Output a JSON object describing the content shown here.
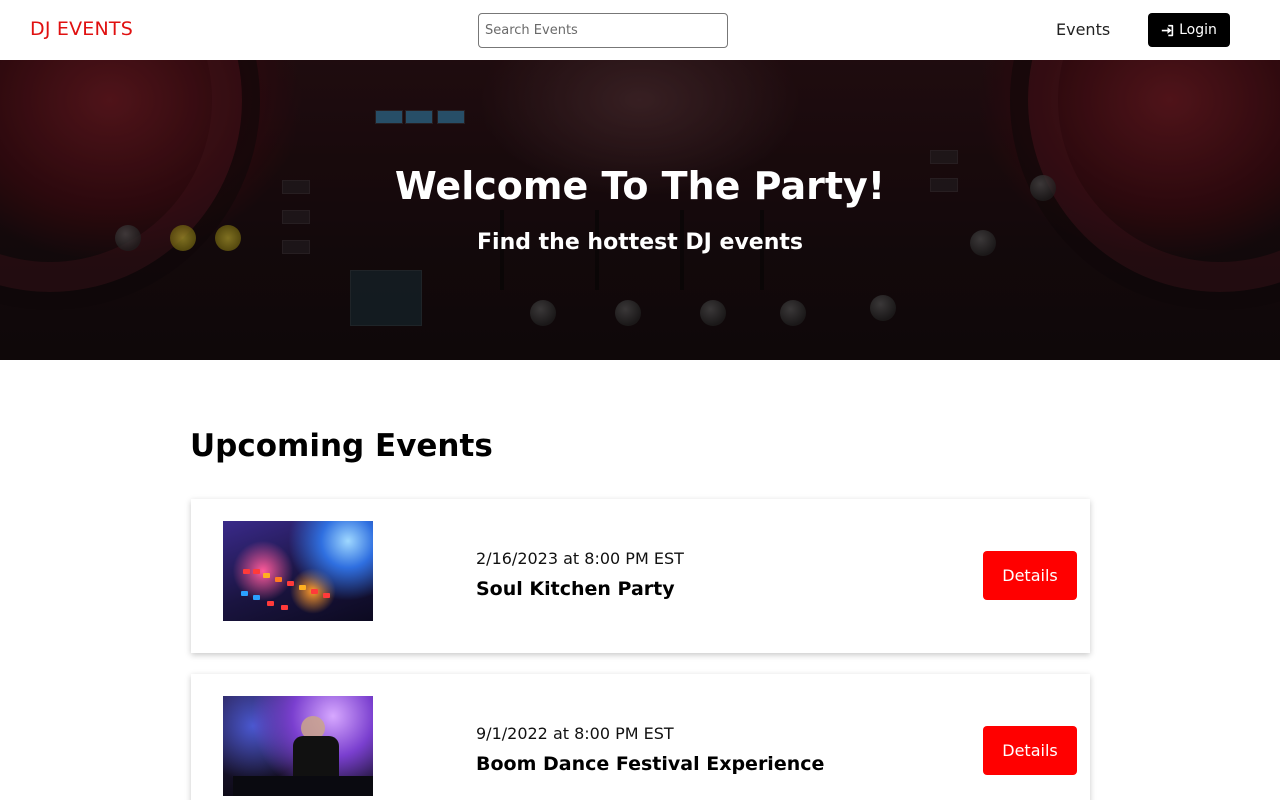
{
  "header": {
    "logo": "DJ EVENTS",
    "search_placeholder": "Search Events",
    "nav_events": "Events",
    "login_label": "Login"
  },
  "hero": {
    "title": "Welcome To The Party!",
    "subtitle": "Find the hottest DJ events"
  },
  "main": {
    "section_title": "Upcoming Events",
    "events": [
      {
        "date": "2/16/2023 at 8:00 PM EST",
        "name": "Soul Kitchen Party",
        "details_label": "Details"
      },
      {
        "date": "9/1/2022 at 8:00 PM EST",
        "name": "Boom Dance Festival Experience",
        "details_label": "Details"
      }
    ]
  },
  "colors": {
    "logo": "#e01010",
    "details_button": "#ff0000",
    "login_button": "#000000"
  }
}
